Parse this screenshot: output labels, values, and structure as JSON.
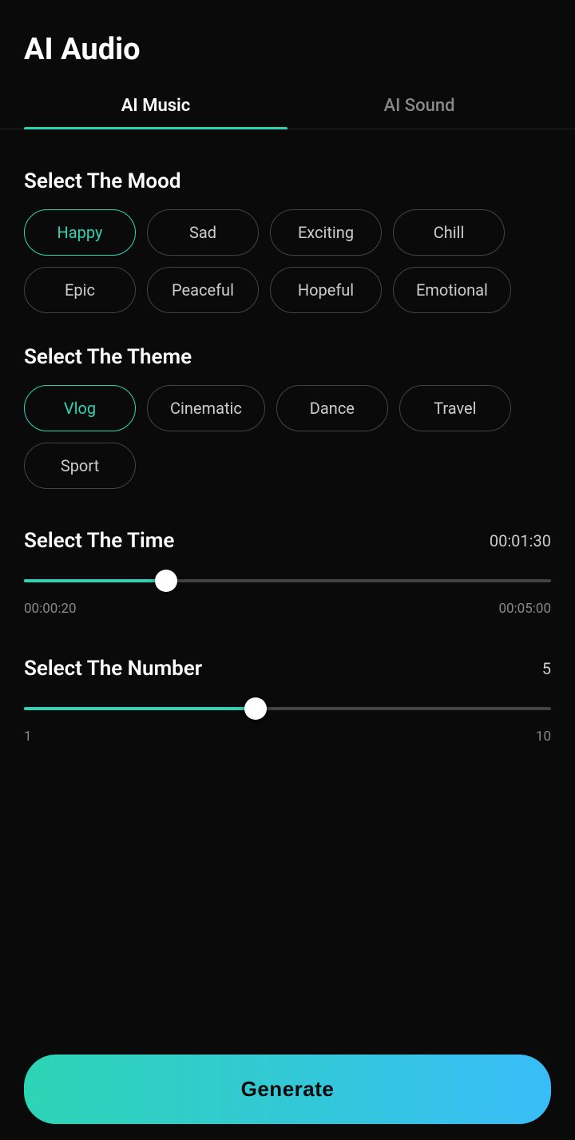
{
  "header": {
    "title": "AI Audio"
  },
  "tabs": [
    {
      "id": "ai-music",
      "label": "AI Music",
      "active": true
    },
    {
      "id": "ai-sound",
      "label": "AI Sound",
      "active": false
    }
  ],
  "mood": {
    "section_title": "Select The Mood",
    "items": [
      {
        "id": "happy",
        "label": "Happy",
        "selected": true
      },
      {
        "id": "sad",
        "label": "Sad",
        "selected": false
      },
      {
        "id": "exciting",
        "label": "Exciting",
        "selected": false
      },
      {
        "id": "chill",
        "label": "Chill",
        "selected": false
      },
      {
        "id": "epic",
        "label": "Epic",
        "selected": false
      },
      {
        "id": "peaceful",
        "label": "Peaceful",
        "selected": false
      },
      {
        "id": "hopeful",
        "label": "Hopeful",
        "selected": false
      },
      {
        "id": "emotional",
        "label": "Emotional",
        "selected": false
      }
    ]
  },
  "theme": {
    "section_title": "Select The Theme",
    "items": [
      {
        "id": "vlog",
        "label": "Vlog",
        "selected": true
      },
      {
        "id": "cinematic",
        "label": "Cinematic",
        "selected": false
      },
      {
        "id": "dance",
        "label": "Dance",
        "selected": false
      },
      {
        "id": "travel",
        "label": "Travel",
        "selected": false
      },
      {
        "id": "sport",
        "label": "Sport",
        "selected": false
      }
    ]
  },
  "time_slider": {
    "section_title": "Select The Time",
    "current_value": "00:01:30",
    "min_label": "00:00:20",
    "max_label": "00:05:00",
    "fill_percent": 27
  },
  "number_slider": {
    "section_title": "Select The Number",
    "current_value": "5",
    "min_label": "1",
    "max_label": "10",
    "fill_percent": 44
  },
  "generate_button": {
    "label": "Generate"
  }
}
